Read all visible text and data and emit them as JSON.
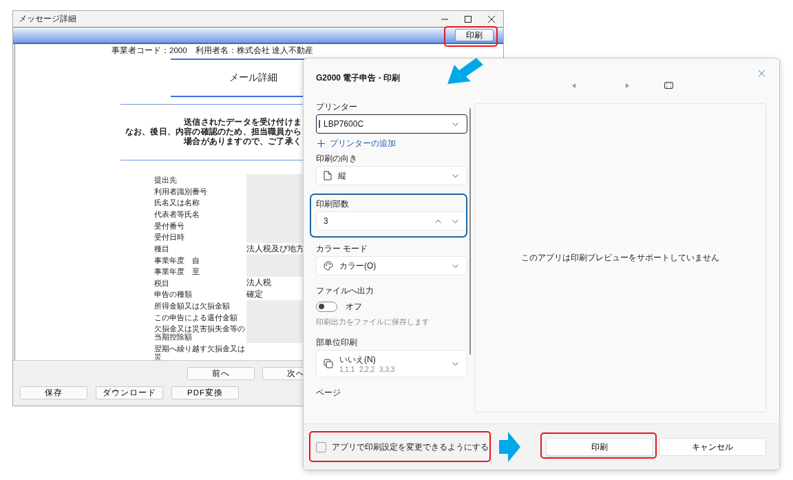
{
  "message_window": {
    "title": "メッセージ詳細",
    "toolbar_button": "印刷",
    "info_line": "事業者コード：2000　利用者名：株式会社 達人不動産",
    "heading": "メール詳細",
    "notice_lines": [
      "送信されたデータを受け付けま",
      "なお、後日、内容の確認のため、担当職員から",
      "場合がありますので、ご了承く"
    ],
    "rows": [
      {
        "label": "提出先",
        "kind": "masked"
      },
      {
        "label": "利用者識別番号",
        "kind": "masked"
      },
      {
        "label": "氏名又は名称",
        "kind": "masked"
      },
      {
        "label": "代表者等氏名",
        "kind": "masked"
      },
      {
        "label": "受付番号",
        "kind": "masked"
      },
      {
        "label": "受付日時",
        "kind": "masked"
      },
      {
        "label": "種目",
        "kind": "text",
        "value": "法人税及び地方"
      },
      {
        "label": "事業年度　自",
        "kind": "masked"
      },
      {
        "label": "事業年度　至",
        "kind": "masked"
      },
      {
        "label": "税目",
        "kind": "text",
        "value": "法人税"
      },
      {
        "label": "申告の種類",
        "kind": "text",
        "value": "確定"
      },
      {
        "label": "所得金額又は欠損金額",
        "kind": "masked"
      },
      {
        "label": "この申告による還付金額",
        "kind": "masked"
      },
      {
        "label": "欠損金又は災害損失金等の当期控除額",
        "kind": "masked"
      },
      {
        "label": "翌期へ繰り越す欠損金又は災",
        "kind": "blank"
      }
    ],
    "nav_buttons": [
      "前へ",
      "次へ"
    ],
    "action_buttons": [
      "保存",
      "ダウンロード",
      "PDF変換"
    ]
  },
  "print_dialog": {
    "title": "G2000 電子申告 - 印刷",
    "settings": [
      {
        "kind": "printer",
        "label": "プリンター",
        "value": "LBP7600C",
        "focused": true
      },
      {
        "kind": "add-printer",
        "label": "プリンターの追加"
      },
      {
        "kind": "orientation",
        "label": "印刷の向き",
        "value": "縦"
      },
      {
        "kind": "copies",
        "label": "印刷部数",
        "value": "3"
      },
      {
        "kind": "color",
        "label": "カラー モード",
        "value": "カラー(O)"
      },
      {
        "kind": "file-output",
        "label": "ファイルへ出力",
        "on": false,
        "state_text": "オフ",
        "hint": "印刷出力をファイルに保存します"
      },
      {
        "kind": "collate",
        "label": "部単位印刷",
        "value": "いいえ(N)",
        "detail": "1,1,1 2,2,2 3,3,3"
      },
      {
        "kind": "heading",
        "label": "ページ"
      }
    ],
    "preview_message": "このアプリは印刷プレビューをサポートしていません",
    "footer": {
      "checkbox": {
        "label": "アプリで印刷設定を変更できるようにする",
        "checked": false
      },
      "buttons": [
        "印刷",
        "キャンセル"
      ]
    }
  }
}
